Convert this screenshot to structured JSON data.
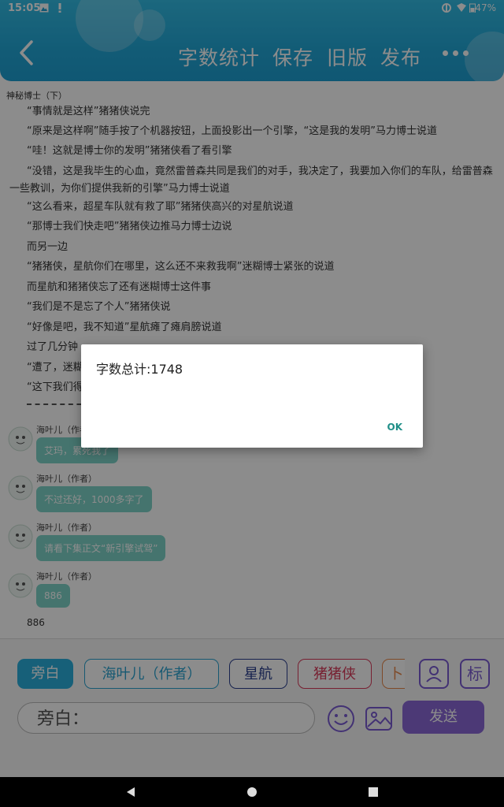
{
  "status_bar": {
    "time": "15:05",
    "battery": "47%"
  },
  "header": {
    "actions": [
      "字数统计",
      "保存",
      "旧版",
      "发布"
    ]
  },
  "document": {
    "title": "神秘博士（下）",
    "paragraphs": [
      "“事情就是这样”猪猪侠说完",
      "“原来是这样啊”随手按了个机器按钮，上面投影出一个引擎，“这是我的发明”马力博士说道",
      "“哇！这就是博士你的发明”猪猪侠看了看引擎",
      "“没错，这是我毕生的心血，竟然雷普森共同是我们的对手，我决定了，我要加入你们的车队，给雷普森一些教训，为你们提供我新的引擎”马力博士说道",
      "“这么看来，超星车队就有救了耶”猪猪侠高兴的对星航说道",
      "“那博士我们快走吧”猪猪侠边推马力博士边说",
      "而另一边",
      "“猪猪侠，星航你们在哪里，这么还不来救我啊”迷糊博士紧张的说道",
      "而星航和猪猪侠忘了还有迷糊博士这件事",
      "“我们是不是忘了个人”猪猪侠说",
      "“好像是吧，我不知道”星航瘫了瘫肩膀说道",
      "过了几分钟",
      "“遭了，迷糊",
      "“这下我们得"
    ]
  },
  "messages": [
    {
      "author": "海叶儿（作者）",
      "text": "艾玛，累死我了"
    },
    {
      "author": "海叶儿（作者）",
      "text": "不过还好，1000多字了"
    },
    {
      "author": "海叶儿（作者）",
      "text": "请看下集正文“新引擎试驾”"
    },
    {
      "author": "海叶儿（作者）",
      "text": "886"
    }
  ],
  "plain_text": "886",
  "roles": [
    {
      "label": "旁白",
      "color": "#2bb0dc",
      "selected": true
    },
    {
      "label": "海叶儿（作者）",
      "color": "#2aa3d0",
      "selected": false
    },
    {
      "label": "星航",
      "color": "#2b3f8f",
      "selected": false
    },
    {
      "label": "猪猪侠",
      "color": "#d93a5a",
      "selected": false
    },
    {
      "label": "卜",
      "color": "#e8884a",
      "selected": false
    }
  ],
  "tools": {
    "role_icon": "person-icon",
    "tag_label": "标"
  },
  "input": {
    "placeholder": "旁白："
  },
  "send_label": "发送",
  "dialog": {
    "message": "字数总计:1748",
    "ok_label": "OK"
  }
}
